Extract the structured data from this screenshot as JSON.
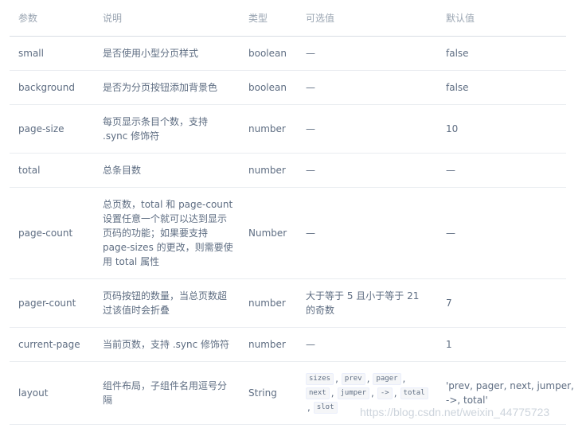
{
  "headers": [
    "参数",
    "说明",
    "类型",
    "可选值",
    "默认值"
  ],
  "rows": [
    {
      "param": "small",
      "desc": [
        "是否使用小型分页样式"
      ],
      "type": "boolean",
      "options": [
        "—"
      ],
      "default": [
        "false"
      ]
    },
    {
      "param": "background",
      "desc": [
        "是否为分页按钮添加背景色"
      ],
      "type": "boolean",
      "options": [
        "—"
      ],
      "default": [
        "false"
      ]
    },
    {
      "param": "page-size",
      "desc": [
        "每页显示条目个数，支持",
        ".sync 修饰符"
      ],
      "type": "number",
      "options": [
        "—"
      ],
      "default": [
        "10"
      ]
    },
    {
      "param": "total",
      "desc": [
        "总条目数"
      ],
      "type": "number",
      "options": [
        "—"
      ],
      "default": [
        "—"
      ]
    },
    {
      "param": "page-count",
      "desc": [
        "总页数，total 和 page-count",
        "设置任意一个就可以达到显示",
        "页码的功能；如果要支持",
        "page-sizes 的更改，则需要使",
        "用 total 属性"
      ],
      "type": "Number",
      "options": [
        "—"
      ],
      "default": [
        "—"
      ]
    },
    {
      "param": "pager-count",
      "desc": [
        "页码按钮的数量，当总页数超",
        "过该值时会折叠"
      ],
      "type": "number",
      "options": [
        "大于等于 5 且小于等于 21",
        "的奇数"
      ],
      "default": [
        "7"
      ]
    },
    {
      "param": "current-page",
      "desc": [
        "当前页数，支持 .sync 修饰符"
      ],
      "type": "number",
      "options": [
        "—"
      ],
      "default": [
        "1"
      ]
    },
    {
      "param": "layout",
      "desc": [
        "组件布局，子组件名用逗号分",
        "隔"
      ],
      "type": "String",
      "option_codes": [
        "sizes",
        "prev",
        "pager",
        "next",
        "jumper",
        "->",
        "total",
        "slot"
      ],
      "default": [
        "'prev, pager, next, jumper,",
        "->, total'"
      ]
    }
  ],
  "watermark": "https://blog.csdn.net/weixin_44775723"
}
